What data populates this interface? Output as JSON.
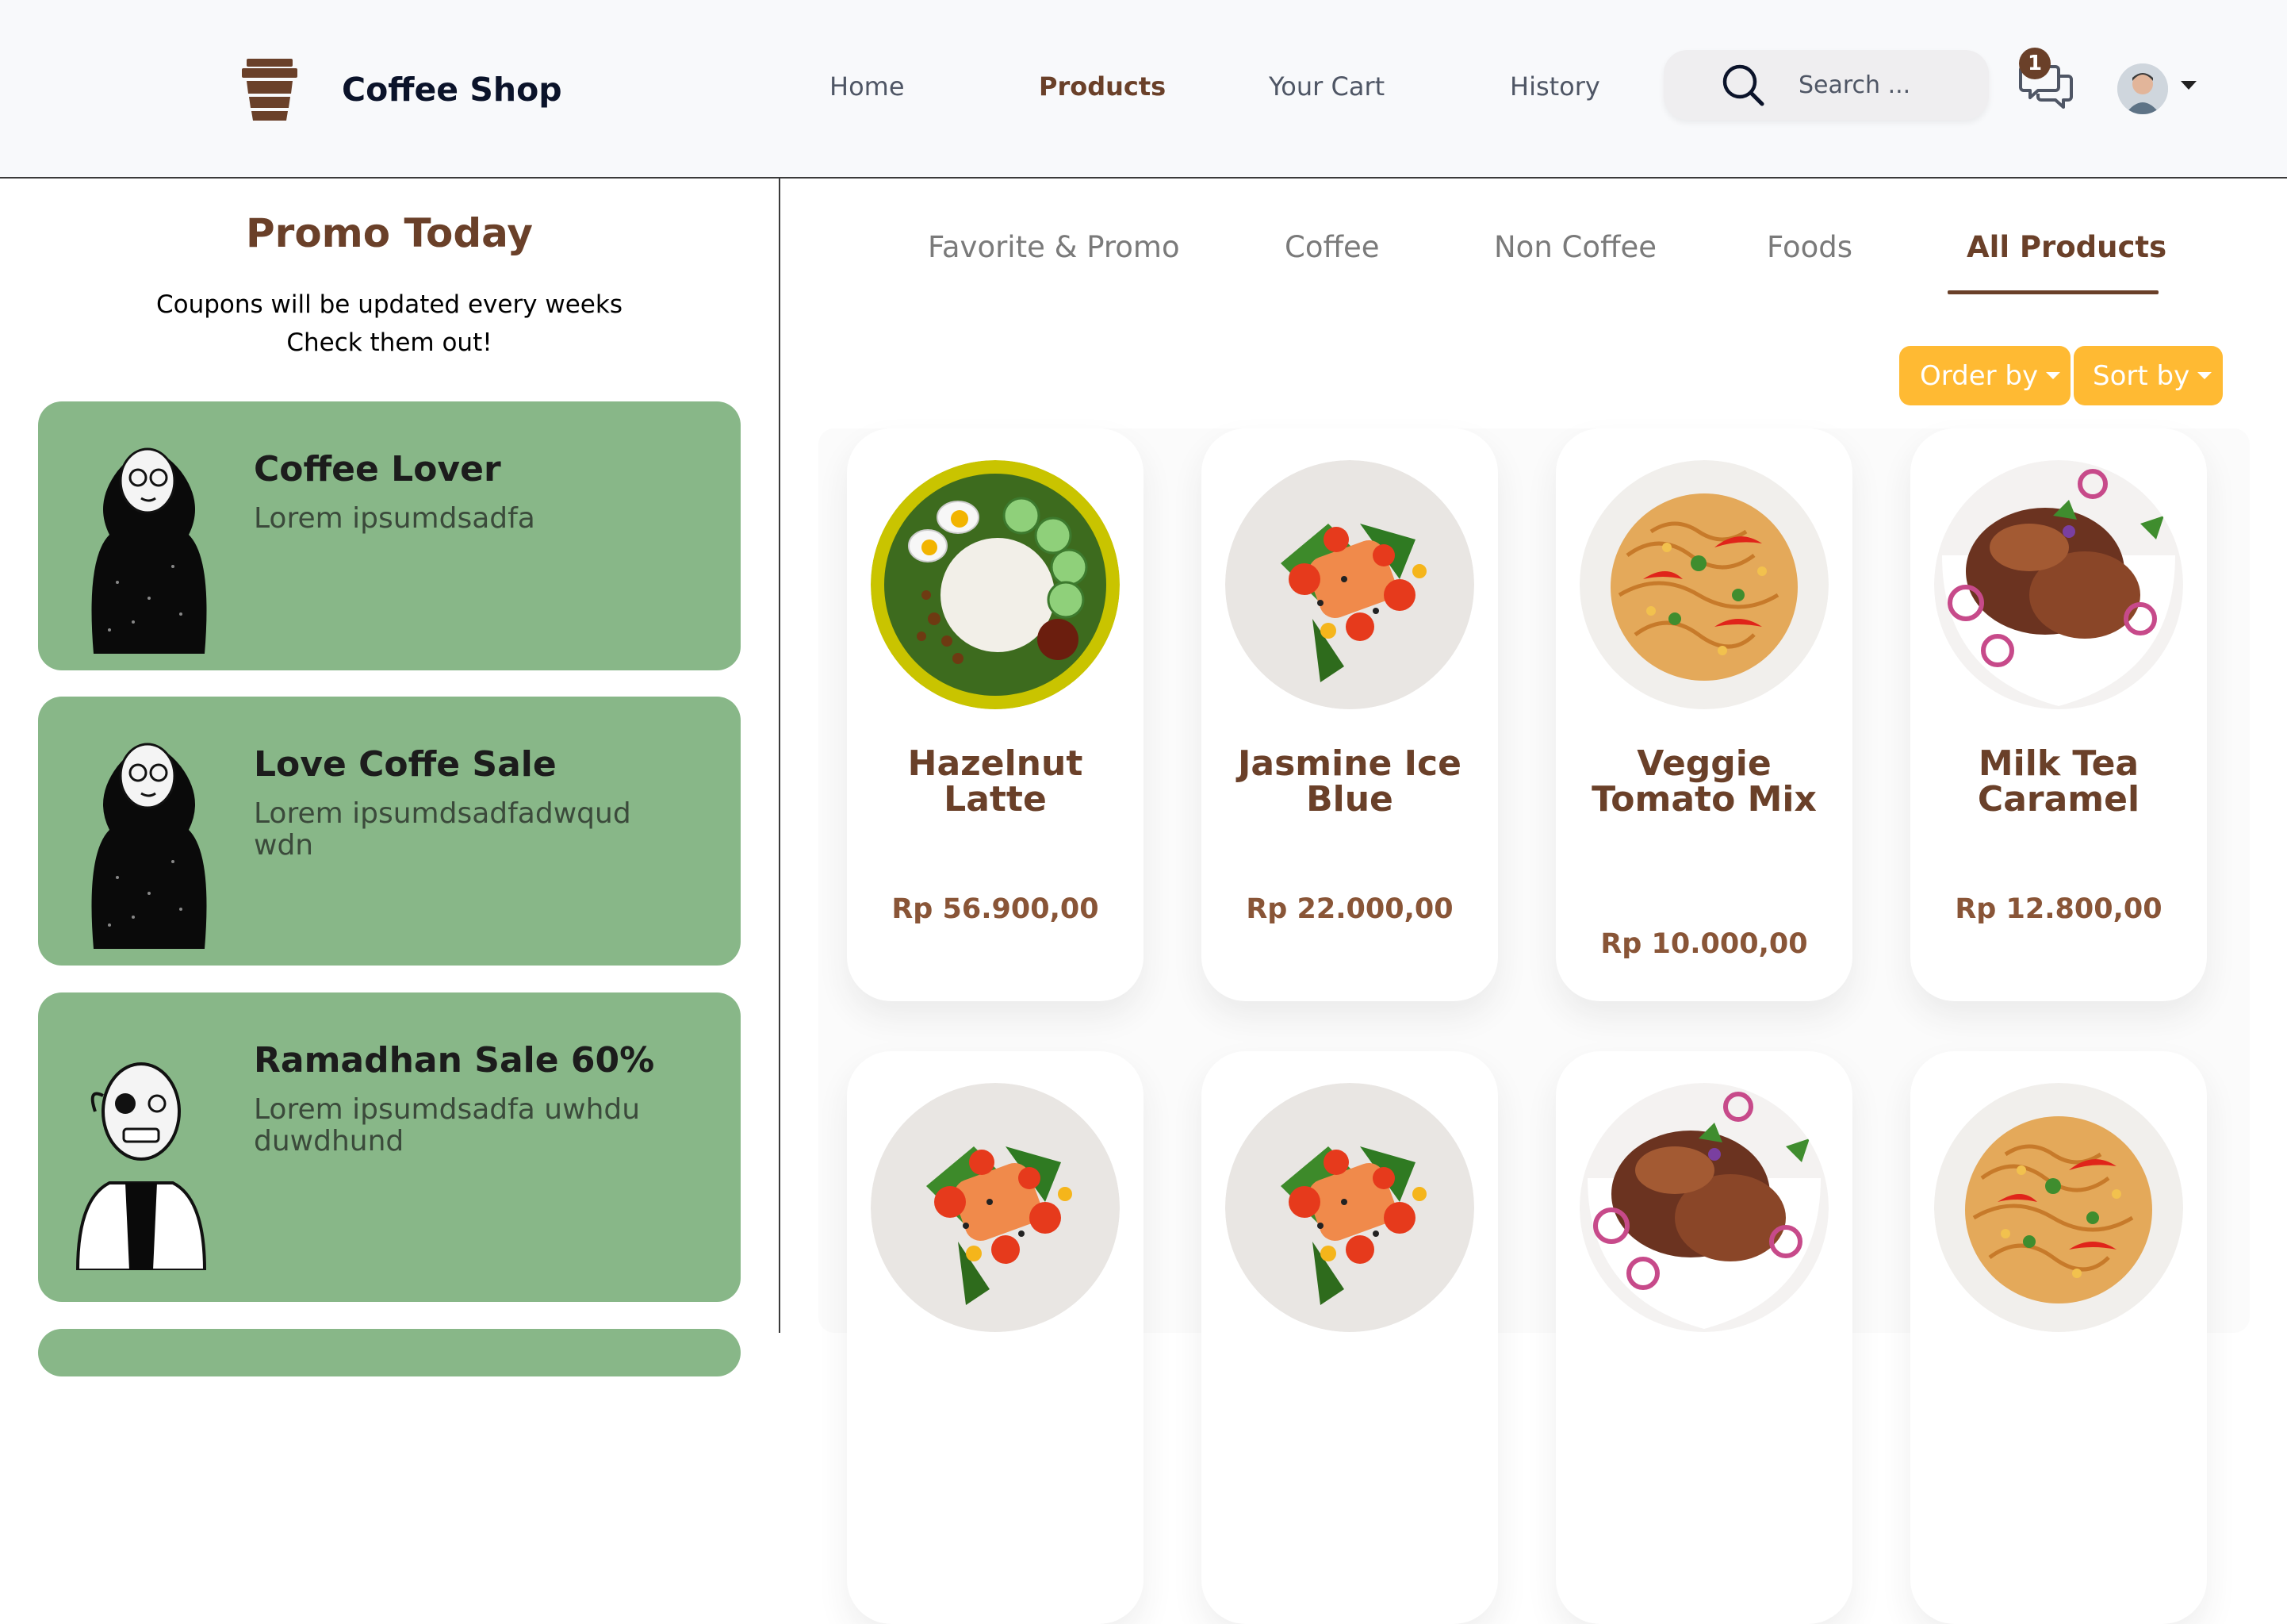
{
  "header": {
    "brand": "Coffee Shop",
    "nav": [
      {
        "label": "Home",
        "active": false
      },
      {
        "label": "Products",
        "active": true
      },
      {
        "label": "Your Cart",
        "active": false
      },
      {
        "label": "History",
        "active": false
      }
    ],
    "search_placeholder": "Search ...",
    "chat_badge": "1",
    "icons": {
      "logo": "coffee-cup-icon",
      "search": "search-icon",
      "chat": "chat-icon",
      "avatar": "avatar",
      "caret": "chevron-down-icon"
    }
  },
  "sidebar": {
    "title": "Promo Today",
    "subtitle_line1": "Coupons will be updated every weeks",
    "subtitle_line2": "Check them out!",
    "coupons": [
      {
        "title": "Coffee Lover",
        "desc": "Lorem ipsumdsadfa",
        "illustration": "hijab-woman-illustration"
      },
      {
        "title": "Love Coffe Sale",
        "desc": "Lorem ipsumdsadfadwqud wdn",
        "illustration": "hijab-woman-illustration"
      },
      {
        "title": "Ramadhan Sale 60%",
        "desc": "Lorem ipsumdsadfa uwhdu duwdhund",
        "illustration": "old-man-illustration"
      }
    ]
  },
  "tabs": [
    {
      "label": "Favorite & Promo",
      "active": false
    },
    {
      "label": "Coffee",
      "active": false
    },
    {
      "label": "Non Coffee",
      "active": false
    },
    {
      "label": "Foods",
      "active": false
    },
    {
      "label": "All Products",
      "active": true
    }
  ],
  "controls": {
    "order_by": "Order by",
    "sort_by": "Sort by"
  },
  "products": [
    {
      "name": "Hazelnut Latte",
      "price": "Rp 56.900,00",
      "image": "nasi-lemak-plate"
    },
    {
      "name": "Jasmine Ice Blue",
      "price": "Rp 22.000,00",
      "image": "salmon-salad-plate"
    },
    {
      "name": "Veggie Tomato Mix",
      "price": "Rp 10.000,00",
      "image": "noodle-plate"
    },
    {
      "name": "Milk Tea Caramel",
      "price": "Rp 12.800,00",
      "image": "glazed-chicken-bowl"
    },
    {
      "name": "",
      "price": "",
      "image": "salmon-salad-plate"
    },
    {
      "name": "",
      "price": "",
      "image": "salmon-salad-plate"
    },
    {
      "name": "",
      "price": "",
      "image": "glazed-chicken-bowl"
    },
    {
      "name": "",
      "price": "",
      "image": "noodle-plate"
    }
  ],
  "colors": {
    "brown": "#6a4029",
    "accent": "#ffba33",
    "coupon_green": "#88b788",
    "header_bg": "#f8f9fb"
  }
}
